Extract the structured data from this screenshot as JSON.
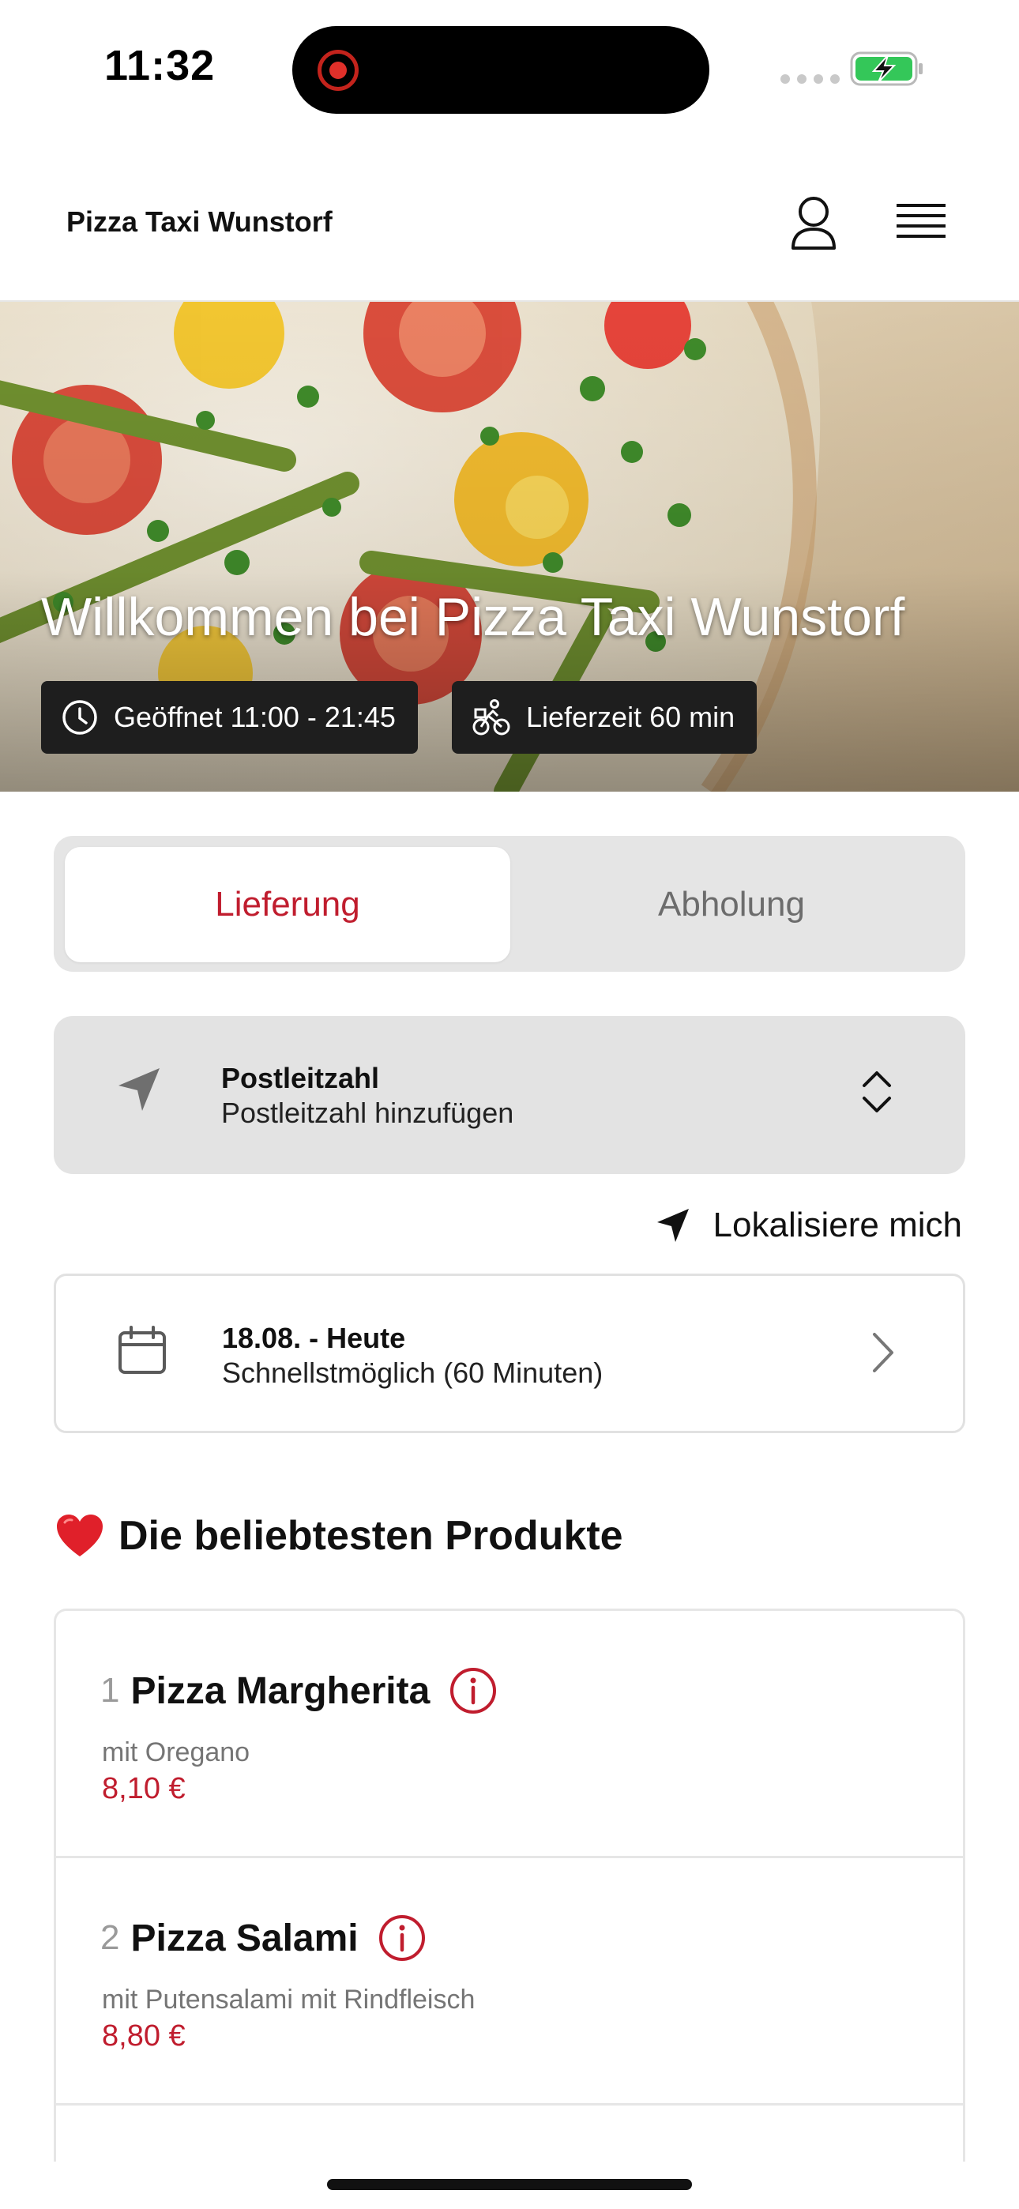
{
  "status_bar": {
    "time": "11:32"
  },
  "header": {
    "brand": "Pizza Taxi Wunstorf"
  },
  "hero": {
    "title": "Willkommen bei Pizza Taxi Wunstorf",
    "opening_hours": "Geöffnet 11:00 - 21:45",
    "delivery_time": "Lieferzeit 60 min"
  },
  "order_mode": {
    "options": [
      {
        "label": "Lieferung",
        "selected": true
      },
      {
        "label": "Abholung",
        "selected": false
      }
    ]
  },
  "postal_code": {
    "label": "Postleitzahl",
    "placeholder": "Postleitzahl hinzufügen"
  },
  "locate": {
    "label": "Lokalisiere mich"
  },
  "schedule": {
    "date": "18.08. - Heute",
    "time": "Schnellstmöglich (60 Minuten)"
  },
  "popular": {
    "title": "Die beliebtesten Produkte",
    "icon": "heart-emoji",
    "products": [
      {
        "number": "1",
        "name": "Pizza Margherita",
        "description": "mit Oregano",
        "price": "8,10 €"
      },
      {
        "number": "2",
        "name": "Pizza Salami",
        "description": "mit Putensalami mit Rindfleisch",
        "price": "8,80 €"
      }
    ]
  },
  "colors": {
    "accent": "#c01d2e",
    "badge_bg": "#1e1e1e",
    "input_bg": "#e3e3e3",
    "battery_green": "#34c759"
  }
}
